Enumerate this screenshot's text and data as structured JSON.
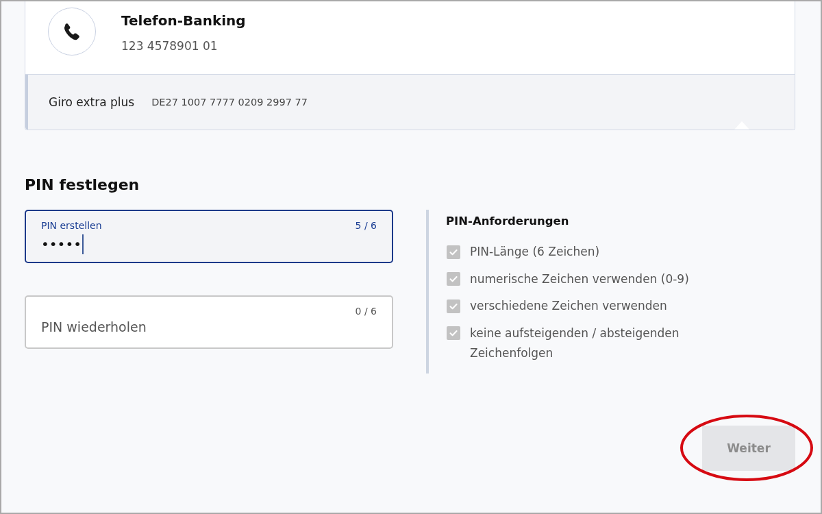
{
  "contact_card": {
    "title": "Telefon-Banking",
    "number": "123 4578901 01",
    "account": {
      "name": "Giro extra plus",
      "iban": "DE27 1007 7777 0209 2997 77"
    }
  },
  "pin_section": {
    "title": "PIN festlegen",
    "fields": [
      {
        "label": "PIN erstellen",
        "counter": "5 / 6",
        "value": "•••••",
        "focused": true
      },
      {
        "placeholder": "PIN wiederholen",
        "counter": "0 / 6",
        "focused": false
      }
    ]
  },
  "requirements": {
    "title": "PIN-Anforderungen",
    "items": [
      {
        "label": "PIN-Länge (6 Zeichen)",
        "checked": true
      },
      {
        "label": "numerische Zeichen verwenden (0-9)",
        "checked": true
      },
      {
        "label": "verschiedene Zeichen verwenden",
        "checked": true
      },
      {
        "label": "keine aufsteigenden / absteigenden Zeichenfolgen",
        "checked": true
      }
    ]
  },
  "next_button": {
    "label": "Weiter",
    "disabled": true,
    "highlighted": true
  }
}
